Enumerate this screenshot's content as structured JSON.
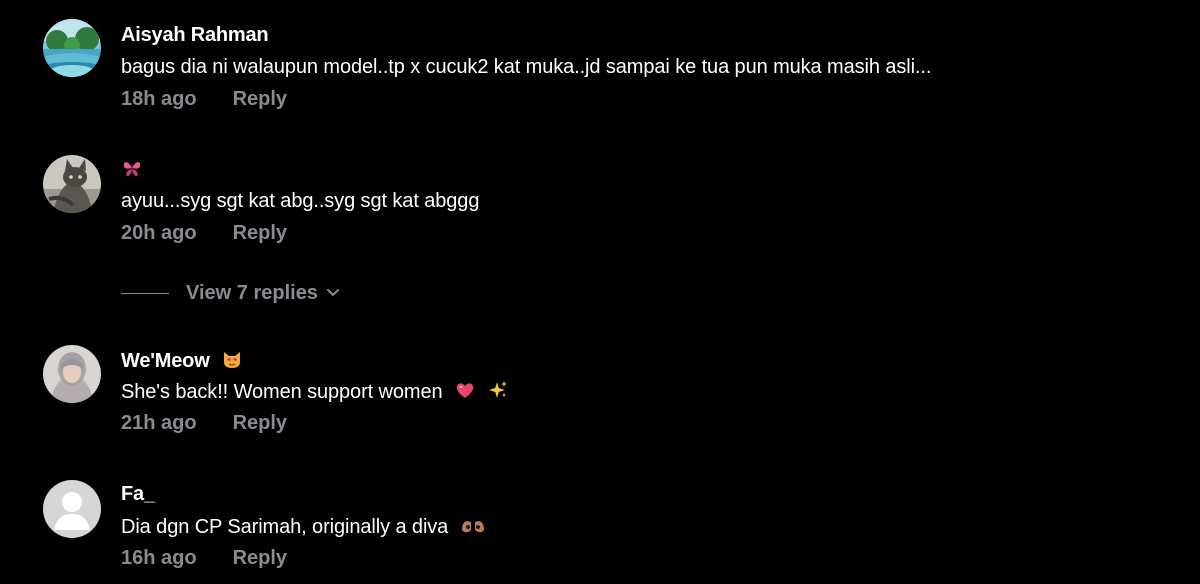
{
  "comments": [
    {
      "username": "Aisyah Rahman",
      "text": "bagus dia ni walaupun model..tp x cucuk2 kat muka..jd sampai ke tua pun muka masih asli...",
      "time": "18h ago",
      "reply_label": "Reply",
      "avatar": "landscape-avatar"
    },
    {
      "username": "",
      "username_emoji": "butterfly-icon",
      "text": "ayuu...syg sgt kat abg..syg sgt kat abggg",
      "time": "20h ago",
      "reply_label": "Reply",
      "avatar": "cat-avatar"
    },
    {
      "username": "We'Meow",
      "username_emoji": "cat-face-icon",
      "text": "She's back!! Women support women",
      "text_emojis": [
        "heart-icon",
        "sparkles-icon"
      ],
      "time": "21h ago",
      "reply_label": "Reply",
      "avatar": "person-hijab-avatar"
    },
    {
      "username": "Fa_",
      "text": "Dia dgn CP Sarimah, originally a diva",
      "text_emojis": [
        "hands-icon"
      ],
      "time": "16h ago",
      "reply_label": "Reply",
      "avatar": "default-avatar"
    }
  ],
  "view_replies": {
    "label": "View 7 replies",
    "icon": "chevron-down-icon"
  },
  "colors": {
    "background": "#000000",
    "primary_text": "#ffffff",
    "secondary_text": "#8a8b91",
    "heart": "#e8466a",
    "default_avatar": "#d6d6d6"
  }
}
